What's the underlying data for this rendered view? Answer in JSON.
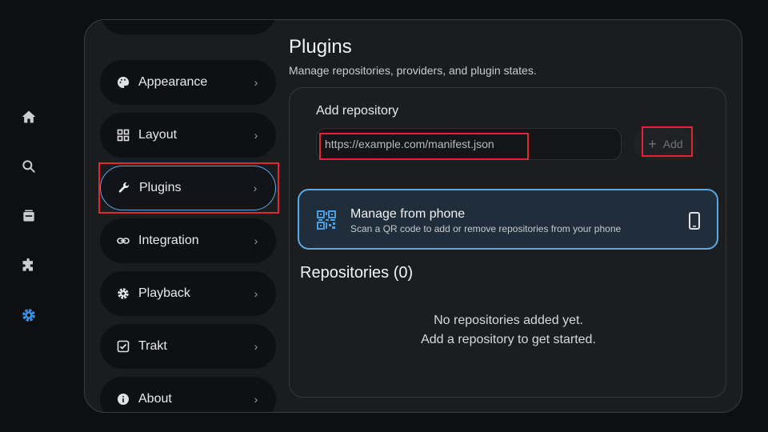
{
  "rail": {
    "items": [
      {
        "icon": "home-icon"
      },
      {
        "icon": "search-icon"
      },
      {
        "icon": "library-icon"
      },
      {
        "icon": "puzzle-icon"
      },
      {
        "icon": "gear-icon",
        "active": true
      }
    ]
  },
  "menu": {
    "items": [
      {
        "label": "Appearance",
        "icon": "palette-icon"
      },
      {
        "label": "Layout",
        "icon": "grid-icon"
      },
      {
        "label": "Plugins",
        "icon": "wrench-icon",
        "active": true
      },
      {
        "label": "Integration",
        "icon": "link-icon"
      },
      {
        "label": "Playback",
        "icon": "gear-icon"
      },
      {
        "label": "Trakt",
        "icon": "checkbox-icon"
      },
      {
        "label": "About",
        "icon": "info-icon"
      }
    ]
  },
  "page": {
    "title": "Plugins",
    "subtitle": "Manage repositories, providers, and plugin states."
  },
  "add_repository": {
    "title": "Add repository",
    "placeholder": "https://example.com/manifest.json",
    "button_label": "Add"
  },
  "phone": {
    "title": "Manage from phone",
    "subtitle": "Scan a QR code to add or remove repositories from your phone"
  },
  "repositories": {
    "title": "Repositories (0)",
    "empty_line1": "No repositories added yet.",
    "empty_line2": "Add a repository to get started."
  },
  "colors": {
    "accent": "#5aa9e6",
    "highlight": "#e0262f",
    "active_rail": "#3b8fe0"
  }
}
